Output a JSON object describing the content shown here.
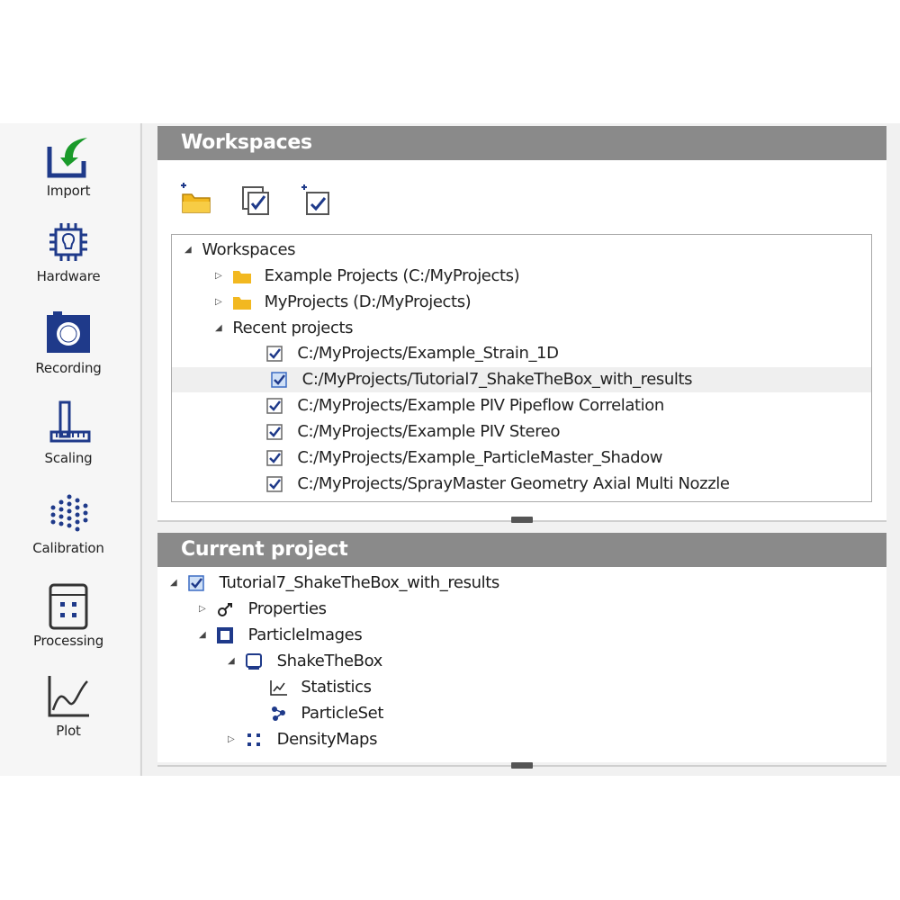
{
  "sidebar": {
    "items": [
      {
        "label": "Import",
        "icon": "import-icon"
      },
      {
        "label": "Hardware",
        "icon": "hardware-icon"
      },
      {
        "label": "Recording",
        "icon": "recording-icon"
      },
      {
        "label": "Scaling",
        "icon": "scaling-icon"
      },
      {
        "label": "Calibration",
        "icon": "calibration-icon"
      },
      {
        "label": "Processing",
        "icon": "processing-icon"
      },
      {
        "label": "Plot",
        "icon": "plot-icon"
      }
    ]
  },
  "workspaces": {
    "title": "Workspaces",
    "toolbar": [
      "add-workspace-folder-icon",
      "select-projects-icon",
      "add-project-icon"
    ],
    "tree": {
      "root": "Workspaces",
      "folders": [
        "Example Projects (C:/MyProjects)",
        "MyProjects (D:/MyProjects)"
      ],
      "recent_label": "Recent projects",
      "recent": [
        "C:/MyProjects/Example_Strain_1D",
        "C:/MyProjects/Tutorial7_ShakeTheBox_with_results",
        "C:/MyProjects/Example PIV Pipeflow Correlation",
        "C:/MyProjects/Example PIV Stereo",
        "C:/MyProjects/Example_ParticleMaster_Shadow",
        "C:/MyProjects/SprayMaster Geometry Axial Multi Nozzle"
      ]
    }
  },
  "current_project": {
    "title": "Current project",
    "project_name": "Tutorial7_ShakeTheBox_with_results",
    "children": [
      {
        "label": "Properties"
      },
      {
        "label": "ParticleImages"
      },
      {
        "label": "ShakeTheBox"
      },
      {
        "label": "Statistics"
      },
      {
        "label": "ParticleSet"
      },
      {
        "label": "DensityMaps"
      }
    ]
  },
  "colors": {
    "header": "#8a8a8a",
    "accent_blue": "#1f3a8a",
    "import_green": "#1a9a2a",
    "folder_yellow": "#f2b820"
  }
}
